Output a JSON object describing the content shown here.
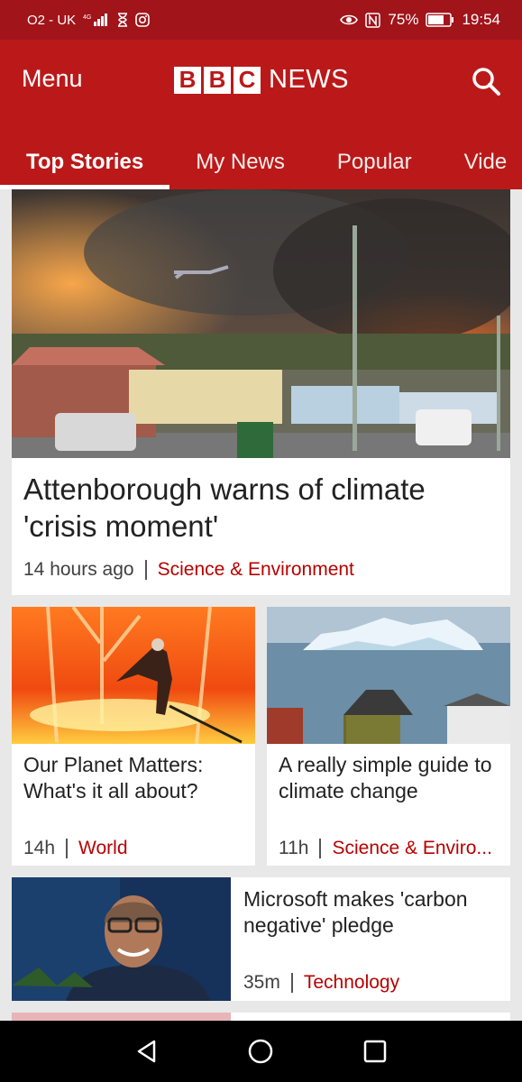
{
  "status_bar": {
    "carrier": "O2 - UK",
    "network": "4G",
    "battery": "75%",
    "time": "19:54"
  },
  "header": {
    "menu_label": "Menu",
    "logo_letters": [
      "B",
      "B",
      "C"
    ],
    "logo_news": "NEWS"
  },
  "tabs": [
    {
      "label": "Top Stories",
      "active": true
    },
    {
      "label": "My News",
      "active": false
    },
    {
      "label": "Popular",
      "active": false
    },
    {
      "label": "Vide",
      "active": false
    }
  ],
  "stories": {
    "hero": {
      "title": "Attenborough warns of climate 'crisis moment'",
      "time": "14 hours ago",
      "category": "Science & Environment"
    },
    "card_left": {
      "title": "Our Planet Matters: What's it all about?",
      "time": "14h",
      "category": "World"
    },
    "card_right": {
      "title": "A really simple guide to climate change",
      "time": "11h",
      "category": "Science & Enviro..."
    },
    "row": {
      "title": "Microsoft makes 'carbon negative' pledge",
      "time": "35m",
      "category": "Technology"
    }
  },
  "colors": {
    "status_bar": "#a1141a",
    "brand_red": "#bb1919",
    "category_red": "#b80000"
  }
}
